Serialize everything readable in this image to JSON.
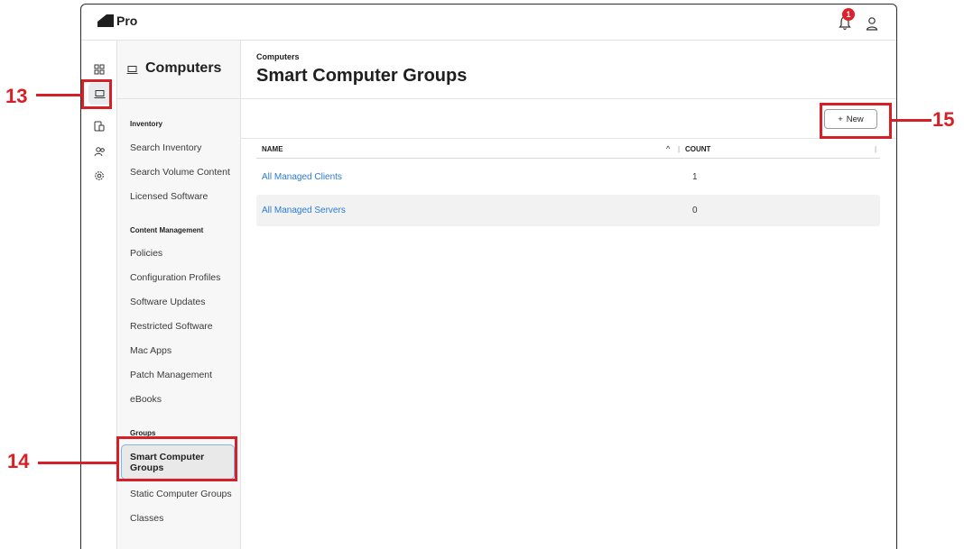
{
  "app": {
    "name": "Pro",
    "notification_count": "1"
  },
  "rail": {
    "icons": [
      "dashboard-icon",
      "computer-icon",
      "devices-icon",
      "users-icon",
      "settings-icon"
    ]
  },
  "subnav": {
    "title": "Computers",
    "sections": [
      {
        "title": "Inventory",
        "items": [
          "Search Inventory",
          "Search Volume Content",
          "Licensed Software"
        ]
      },
      {
        "title": "Content Management",
        "items": [
          "Policies",
          "Configuration Profiles",
          "Software Updates",
          "Restricted Software",
          "Mac Apps",
          "Patch Management",
          "eBooks"
        ]
      },
      {
        "title": "Groups",
        "items": [
          "Smart Computer Groups",
          "Static Computer Groups",
          "Classes"
        ]
      }
    ],
    "active": "Smart Computer Groups"
  },
  "main": {
    "breadcrumb": "Computers",
    "title": "Smart Computer Groups",
    "new_button": "New",
    "table": {
      "columns": [
        "NAME",
        "COUNT"
      ],
      "rows": [
        {
          "name": "All Managed Clients",
          "count": "1"
        },
        {
          "name": "All Managed Servers",
          "count": "0"
        }
      ]
    }
  },
  "callouts": {
    "c13": "13",
    "c14": "14",
    "c15": "15"
  },
  "colors": {
    "accent": "#d52027",
    "link": "#2a7bd4",
    "badge": "#e0202a",
    "active_border": "#7ab8ec"
  }
}
